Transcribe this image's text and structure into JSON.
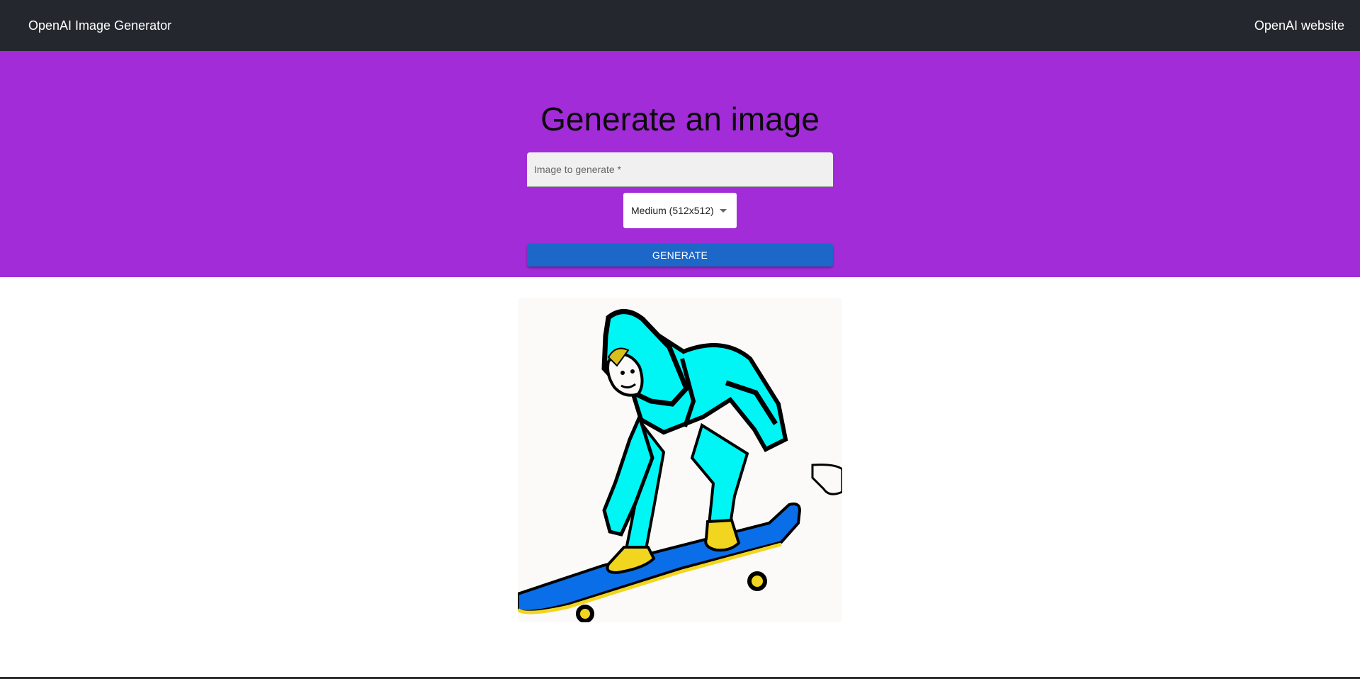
{
  "navbar": {
    "brand": "OpenAI Image Generator",
    "link": "OpenAI website"
  },
  "hero": {
    "title": "Generate an image",
    "prompt_placeholder": "Image to generate *",
    "prompt_value": "",
    "size_selected": "Medium (512x512)",
    "generate_label": "GENERATE"
  },
  "colors": {
    "navbar": "#24282e",
    "hero": "#a22cd8",
    "button": "#1d67c9"
  },
  "result": {
    "icon": "generated-image"
  }
}
